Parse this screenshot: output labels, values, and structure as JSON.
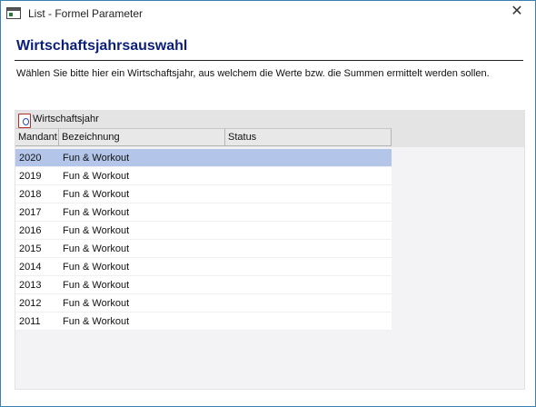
{
  "window": {
    "title": "List - Formel Parameter",
    "close_glyph": "✕"
  },
  "header": {
    "heading": "Wirtschaftsjahrsauswahl",
    "description": "Wählen Sie bitte hier ein Wirtschaftsjahr, aus welchem die Werte bzw. die Summen ermittelt werden sollen."
  },
  "grid": {
    "group_label": "Wirtschaftsjahr",
    "columns": [
      "Mandant",
      "Bezeichnung",
      "Status"
    ],
    "rows": [
      {
        "mandant": "2020",
        "bezeichnung": "Fun & Workout",
        "status": "",
        "selected": true
      },
      {
        "mandant": "2019",
        "bezeichnung": "Fun & Workout",
        "status": ""
      },
      {
        "mandant": "2018",
        "bezeichnung": "Fun & Workout",
        "status": ""
      },
      {
        "mandant": "2017",
        "bezeichnung": "Fun & Workout",
        "status": ""
      },
      {
        "mandant": "2016",
        "bezeichnung": "Fun & Workout",
        "status": ""
      },
      {
        "mandant": "2015",
        "bezeichnung": "Fun & Workout",
        "status": ""
      },
      {
        "mandant": "2014",
        "bezeichnung": "Fun & Workout",
        "status": ""
      },
      {
        "mandant": "2013",
        "bezeichnung": "Fun & Workout",
        "status": ""
      },
      {
        "mandant": "2012",
        "bezeichnung": "Fun & Workout",
        "status": ""
      },
      {
        "mandant": "2011",
        "bezeichnung": "Fun & Workout",
        "status": ""
      }
    ]
  },
  "colors": {
    "heading": "#0b1f7a",
    "selected_row": "#b3c6ea",
    "window_border": "#3c7fb1"
  },
  "icons": {
    "app": "app-window-icon",
    "group": "fiscal-year-icon",
    "close": "close-icon"
  }
}
